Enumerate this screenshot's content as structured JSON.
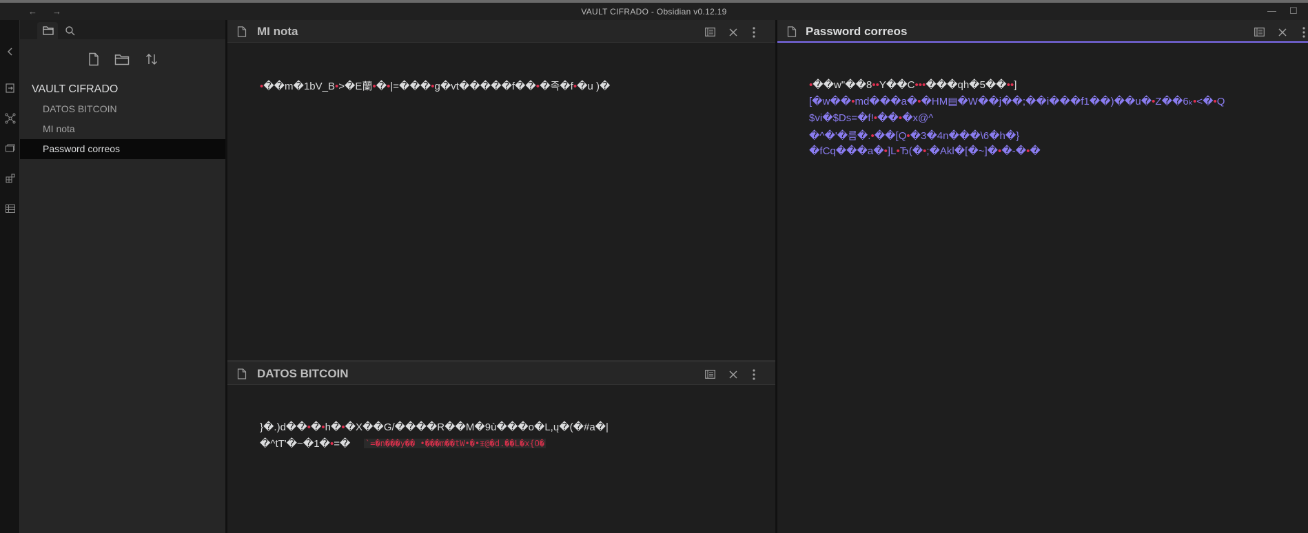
{
  "window": {
    "title": "VAULT CIFRADO - Obsidian v0.12.19",
    "back_arrow": "←",
    "forward_arrow": "→",
    "minimize": "—",
    "maximize": "☐"
  },
  "sidebar": {
    "vault_name": "VAULT CIFRADO",
    "files": [
      {
        "label": "DATOS BITCOIN"
      },
      {
        "label": "MI nota"
      },
      {
        "label": "Password correos"
      }
    ]
  },
  "panes": {
    "mi_nota": {
      "title": "MI nota",
      "content": [
        "•��m�1bV_B•>�E蘭•�•|=���•g�vt�����f��•�족�f•�u   )�"
      ]
    },
    "datos_bitcoin": {
      "title": "DATOS BITCOIN",
      "content": [
        "}�.)d��•�•h�•�X��G/����R��M�9ù���o�L,ų�(�#a�|",
        "�^tT'�~�1�•=�"
      ],
      "code_span": "`=�n���y�� •���m��tW•�•ᵻ@�d.��L�x{O�"
    },
    "password_correos": {
      "title": "Password correos",
      "content": [
        "•��w\"��8••Y��C•••���qh�5��••]",
        "[�w��•md���a�•�HM▤�W��j��;��i���f1��)��u�•Z��6ₖ•<�•Q",
        "$vi�$Ds=�f!•��•�x@^",
        "�^�'�름�.•��[Q•�3�4n���\\6�h�}",
        "�fCq���a�•]L•Ђ(�•;�Akl�[�~]�•�-�•�"
      ]
    }
  },
  "colors": {
    "accent": "#7f6df2",
    "bullet_red": "#e03050",
    "purple_text": "#8a7cf0"
  }
}
